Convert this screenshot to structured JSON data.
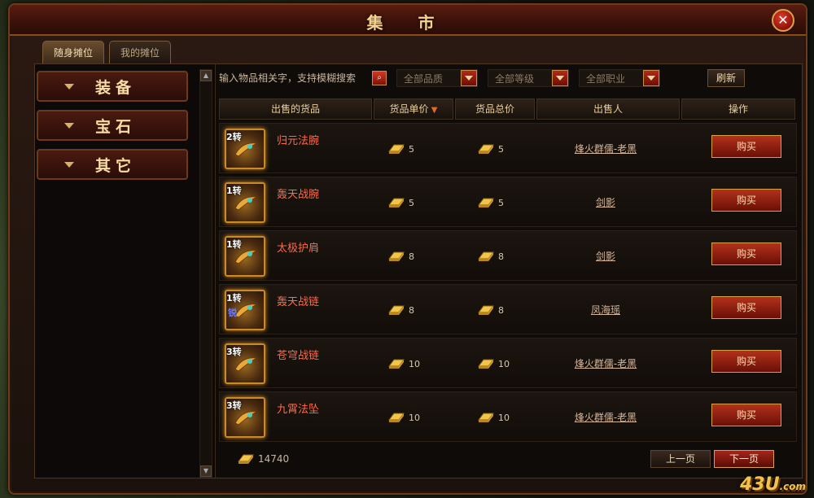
{
  "window": {
    "title": "集 市",
    "close_symbol": "✕"
  },
  "tabs": [
    {
      "label": "随身摊位",
      "active": true
    },
    {
      "label": "我的摊位",
      "active": false
    }
  ],
  "sidebar": {
    "categories": [
      "装备",
      "宝石",
      "其它"
    ]
  },
  "filters": {
    "search_placeholder": "输入物品相关字，支持模糊搜索",
    "quality": "全部品质",
    "level": "全部等级",
    "job": "全部职业",
    "refresh_label": "刷新"
  },
  "table": {
    "headers": [
      "出售的货品",
      "货品单价",
      "货品总价",
      "出售人",
      "操作"
    ],
    "rows": [
      {
        "rank": "2转",
        "name": "归元法腕",
        "unit_price": "5",
        "total_price": "5",
        "seller": "烽火群儒-老黑",
        "action": "购买"
      },
      {
        "rank": "1转",
        "name": "轰天战腕",
        "unit_price": "5",
        "total_price": "5",
        "seller": "剑影",
        "action": "购买"
      },
      {
        "rank": "1转",
        "name": "太极护肩",
        "unit_price": "8",
        "total_price": "8",
        "seller": "剑影",
        "action": "购买"
      },
      {
        "rank": "1转",
        "name": "轰天战链",
        "unit_price": "8",
        "total_price": "8",
        "seller": "凤海瑶",
        "action": "购买",
        "badge": "锐"
      },
      {
        "rank": "3转",
        "name": "苍穹战链",
        "unit_price": "10",
        "total_price": "10",
        "seller": "烽火群儒-老黑",
        "action": "购买"
      },
      {
        "rank": "3转",
        "name": "九霄法坠",
        "unit_price": "10",
        "total_price": "10",
        "seller": "烽火群儒-老黑",
        "action": "购买"
      }
    ]
  },
  "footer": {
    "gold_amount": "14740",
    "prev_label": "上一页",
    "next_label": "下一页"
  },
  "watermark": {
    "main": "43U",
    "suffix": ".com"
  },
  "colors": {
    "accent": "#f7d28c",
    "item_name": "#ff6a4a",
    "buy_button": "#b3321c"
  }
}
